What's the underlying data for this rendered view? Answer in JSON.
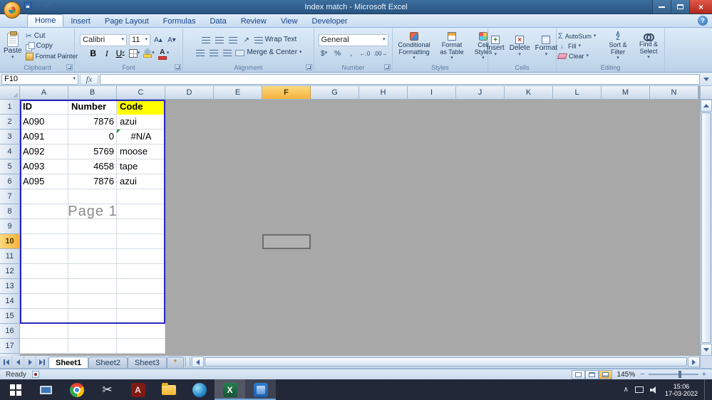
{
  "window": {
    "title": "Index match - Microsoft Excel"
  },
  "icons": {
    "dropdown": "▾",
    "undo": "↺",
    "redo": "↻",
    "scissors": "✂",
    "sigma": "Σ",
    "help": "?",
    "chevron_up": "∧",
    "dollar": "$",
    "percent": "%",
    "comma": ",",
    "increase_decimal": "←.0",
    "decrease_decimal": ".00→",
    "grow_font": "A▴",
    "shrink_font": "A▾",
    "orientation": "↗",
    "close": "×",
    "minus": "−",
    "plus": "+",
    "adobe_a": "A",
    "excel_x": "X"
  },
  "ribbon": {
    "tabs": [
      {
        "label": "Home",
        "active": true
      },
      {
        "label": "Insert",
        "active": false
      },
      {
        "label": "Page Layout",
        "active": false
      },
      {
        "label": "Formulas",
        "active": false
      },
      {
        "label": "Data",
        "active": false
      },
      {
        "label": "Review",
        "active": false
      },
      {
        "label": "View",
        "active": false
      },
      {
        "label": "Developer",
        "active": false
      }
    ],
    "clipboard": {
      "label": "Clipboard",
      "paste": "Paste",
      "cut": "Cut",
      "copy": "Copy",
      "format_painter": "Format Painter"
    },
    "font": {
      "label": "Font",
      "font_name": "Calibri",
      "font_size": "11",
      "bold": "B",
      "italic": "I",
      "underline": "U"
    },
    "alignment": {
      "label": "Alignment",
      "wrap_text": "Wrap Text",
      "merge_center": "Merge & Center"
    },
    "number": {
      "label": "Number",
      "format": "General"
    },
    "styles": {
      "label": "Styles",
      "conditional": "Conditional Formatting",
      "format_table": "Format as Table",
      "cell_styles": "Cell Styles"
    },
    "cells": {
      "label": "Cells",
      "insert": "Insert",
      "delete": "Delete",
      "format": "Format"
    },
    "editing": {
      "label": "Editing",
      "autosum": "AutoSum",
      "fill": "Fill",
      "clear": "Clear",
      "sort_filter": "Sort & Filter",
      "find_select": "Find & Select"
    }
  },
  "formula_bar": {
    "name_box": "F10",
    "fx": "fx",
    "formula": ""
  },
  "sheet": {
    "columns": [
      "A",
      "B",
      "C",
      "D",
      "E",
      "F",
      "G",
      "H",
      "I",
      "J",
      "K",
      "L",
      "M",
      "N"
    ],
    "row_labels": [
      "1",
      "2",
      "3",
      "4",
      "5",
      "6",
      "7",
      "8",
      "9",
      "10",
      "11",
      "12",
      "13",
      "14",
      "15",
      "16",
      "17"
    ],
    "selected_column": "F",
    "selected_row": 10,
    "selected_cell": "F10",
    "page_watermark": "Page 1",
    "cells": [
      {
        "r": 1,
        "c": "A",
        "t": "ID",
        "bold": true
      },
      {
        "r": 1,
        "c": "B",
        "t": "Number",
        "bold": true
      },
      {
        "r": 1,
        "c": "C",
        "t": "Code",
        "bold": true,
        "bg": "#ffff00"
      },
      {
        "r": 2,
        "c": "A",
        "t": "A090"
      },
      {
        "r": 2,
        "c": "B",
        "t": "7876",
        "align": "right"
      },
      {
        "r": 2,
        "c": "C",
        "t": "azui"
      },
      {
        "r": 3,
        "c": "A",
        "t": "A091"
      },
      {
        "r": 3,
        "c": "B",
        "t": "0",
        "align": "right"
      },
      {
        "r": 3,
        "c": "C",
        "t": "#N/A",
        "align": "center",
        "error": true
      },
      {
        "r": 4,
        "c": "A",
        "t": "A092"
      },
      {
        "r": 4,
        "c": "B",
        "t": "5769",
        "align": "right"
      },
      {
        "r": 4,
        "c": "C",
        "t": "moose"
      },
      {
        "r": 5,
        "c": "A",
        "t": "A093"
      },
      {
        "r": 5,
        "c": "B",
        "t": "4658",
        "align": "right"
      },
      {
        "r": 5,
        "c": "C",
        "t": "tape"
      },
      {
        "r": 6,
        "c": "A",
        "t": "A095"
      },
      {
        "r": 6,
        "c": "B",
        "t": "7876",
        "align": "right"
      },
      {
        "r": 6,
        "c": "C",
        "t": "azui"
      }
    ]
  },
  "sheet_tabs": {
    "tabs": [
      {
        "label": "Sheet1",
        "active": true
      },
      {
        "label": "Sheet2",
        "active": false
      },
      {
        "label": "Sheet3",
        "active": false
      }
    ]
  },
  "status_bar": {
    "ready": "Ready",
    "zoom": "145%"
  },
  "taskbar": {
    "time": "15:06",
    "date": "17-03-2022"
  },
  "colors": {
    "header_selected": "#f6b33d",
    "page_border_blue": "#2626c4",
    "code_header_yellow": "#ffff00",
    "close_button_red": "#b3281c",
    "taskbar_bg": "#232839"
  }
}
